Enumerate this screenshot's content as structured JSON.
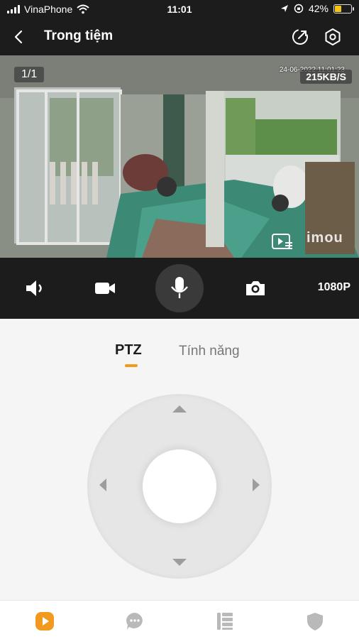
{
  "status_bar": {
    "carrier": "VinaPhone",
    "time": "11:01",
    "battery_percent": "42%",
    "battery_level": 0.42
  },
  "nav": {
    "title": "Trong tiệm",
    "icons": [
      "back-icon",
      "share-icon",
      "settings-gear-icon"
    ]
  },
  "video": {
    "channel_counter": "1/1",
    "timestamp": "24-06-2022 11:01:23",
    "bitrate": "215KB/S",
    "watermark": "imou",
    "icons": [
      "playback-list-icon"
    ]
  },
  "controls": {
    "icons": [
      "speaker-icon",
      "record-video-icon",
      "microphone-icon",
      "camera-snapshot-icon"
    ],
    "resolution": "1080P"
  },
  "tabs": {
    "ptz_label": "PTZ",
    "features_label": "Tính năng",
    "active": "PTZ",
    "accent": "#f29a1f"
  },
  "ptz": {
    "icons": [
      "arrow-up-icon",
      "arrow-down-icon",
      "arrow-left-icon",
      "arrow-right-icon"
    ]
  },
  "bottom_nav": {
    "items": [
      "live-play-icon",
      "message-icon",
      "list-icon",
      "shield-icon"
    ],
    "active_index": 0
  }
}
